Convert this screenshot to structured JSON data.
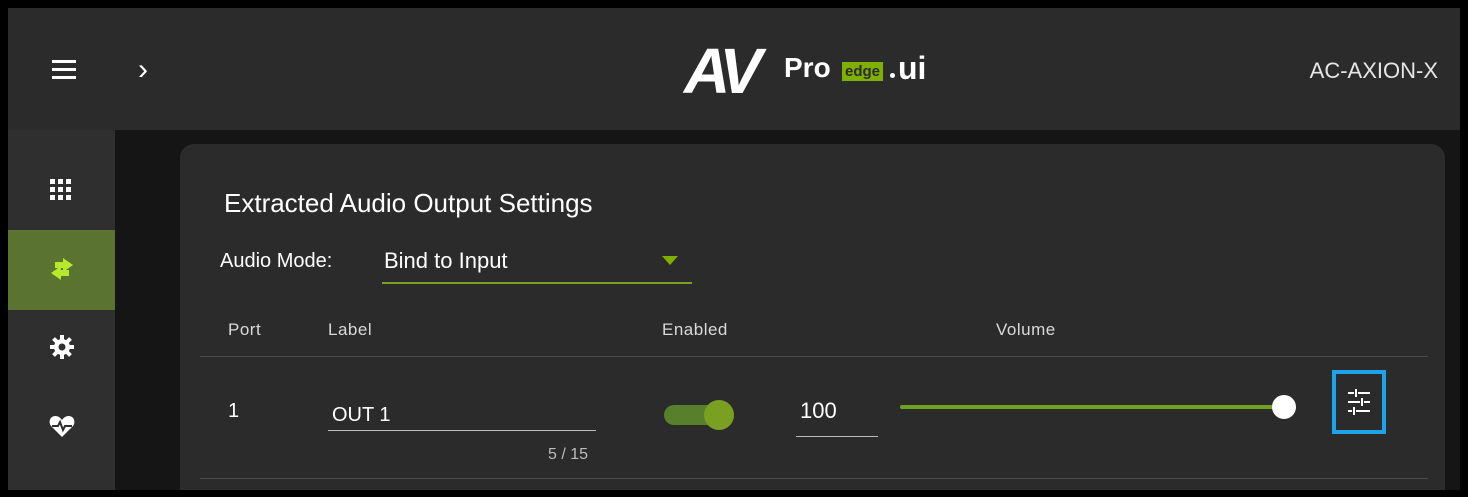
{
  "header": {
    "logo": {
      "av": "AV",
      "pro": "Pro",
      "edge": "edge",
      "ui": "ui"
    },
    "device_name": "AC-AXION-X",
    "menu_icon": "hamburger-icon",
    "expand_icon": "chevron-right-icon"
  },
  "sidebar": {
    "items": [
      {
        "name": "grid-icon",
        "active": false
      },
      {
        "name": "routing-arrows-icon",
        "active": true
      },
      {
        "name": "gear-icon",
        "active": false
      },
      {
        "name": "health-heart-icon",
        "active": false
      }
    ]
  },
  "card": {
    "title": "Extracted Audio Output Settings",
    "audio_mode_label": "Audio Mode:",
    "audio_mode_value": "Bind to Input",
    "columns": {
      "port": "Port",
      "label": "Label",
      "enabled": "Enabled",
      "volume": "Volume"
    },
    "rows": [
      {
        "port": "1",
        "label": "OUT 1",
        "char_count": "5 / 15",
        "enabled": true,
        "volume": "100",
        "volume_fraction": 1.0
      }
    ]
  },
  "colors": {
    "accent_green": "#7fb000",
    "active_nav": "#5b7330",
    "highlight_blue": "#1fa3e8"
  }
}
